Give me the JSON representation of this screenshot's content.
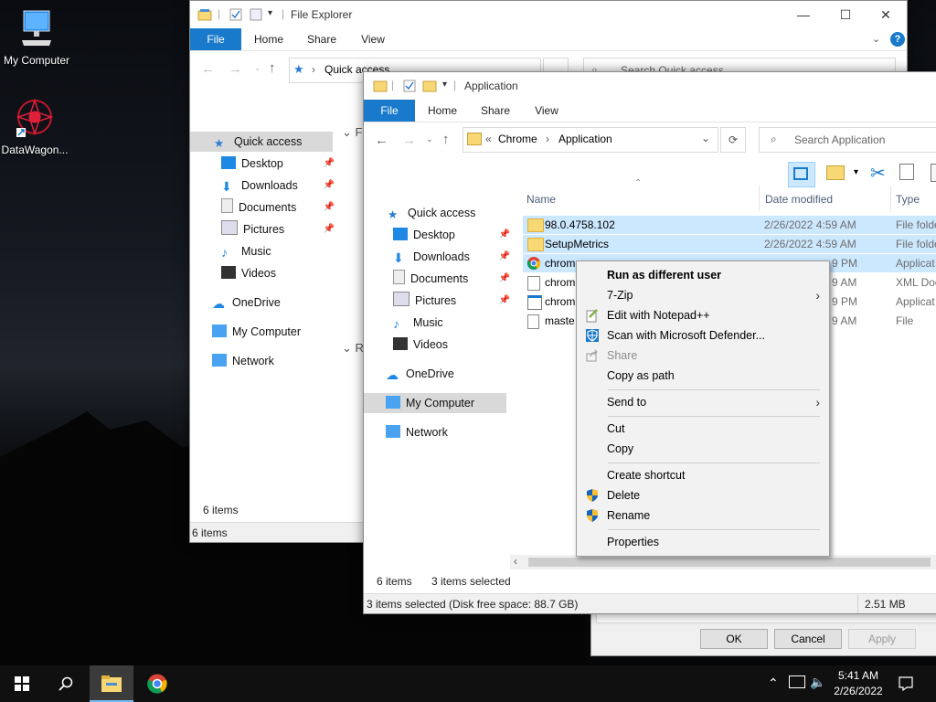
{
  "desktop": {
    "icons": [
      {
        "label": "My Computer"
      },
      {
        "label": "DataWagon..."
      }
    ]
  },
  "explorer_back": {
    "title": "File Explorer",
    "ribbon_tabs": [
      "File",
      "Home",
      "Share",
      "View"
    ],
    "address_text": "Quick access",
    "search_placeholder": "Search Quick access",
    "nav": [
      "Quick access",
      "Desktop",
      "Downloads",
      "Documents",
      "Pictures",
      "Music",
      "Videos",
      "OneDrive",
      "My Computer",
      "Network"
    ],
    "group_letters": [
      "F",
      "R"
    ],
    "status_items": "6 items",
    "status_bottom": "6 items"
  },
  "explorer_front": {
    "title": "Application",
    "ribbon_tabs": [
      "File",
      "Home",
      "Share",
      "View"
    ],
    "breadcrumb": {
      "prefix": "«",
      "parts": [
        "Chrome",
        "Application"
      ]
    },
    "search_placeholder": "Search Application",
    "nav": [
      "Quick access",
      "Desktop",
      "Downloads",
      "Documents",
      "Pictures",
      "Music",
      "Videos",
      "OneDrive",
      "My Computer",
      "Network"
    ],
    "columns": [
      "Name",
      "Date modified",
      "Type"
    ],
    "rows": [
      {
        "name": "98.0.4758.102",
        "date": "2/26/2022 4:59 AM",
        "type": "File folde"
      },
      {
        "name": "SetupMetrics",
        "date": "2/26/2022 4:59 AM",
        "type": "File folde"
      },
      {
        "name": "chrom",
        "date": "",
        "date_tail": "9 PM",
        "type": "Applicat"
      },
      {
        "name": "chrom",
        "date_tail": "9 AM",
        "type": "XML Doc"
      },
      {
        "name": "chrom",
        "date_tail": "9 PM",
        "type": "Applicat"
      },
      {
        "name": "maste",
        "date_tail": "9 AM",
        "type": "File"
      }
    ],
    "status_left": "6 items",
    "status_selected": "3 items selected",
    "status_bar": "3 items selected (Disk free space: 88.7 GB)",
    "status_size": "2.51 MB"
  },
  "context_menu": {
    "items": [
      {
        "label": "Run as different user",
        "bold": true
      },
      {
        "label": "7-Zip",
        "submenu": true
      },
      {
        "label": "Edit with Notepad++",
        "icon": "notepad-icon"
      },
      {
        "label": "Scan with Microsoft Defender...",
        "icon": "defender-icon"
      },
      {
        "label": "Share",
        "icon": "share-icon",
        "disabled": true
      },
      {
        "label": "Copy as path"
      },
      {
        "label": "Send to",
        "submenu": true
      },
      {
        "label": "Cut"
      },
      {
        "label": "Copy"
      },
      {
        "label": "Create shortcut"
      },
      {
        "label": "Delete",
        "icon": "shield-icon"
      },
      {
        "label": "Rename",
        "icon": "shield-icon"
      },
      {
        "label": "Properties"
      }
    ]
  },
  "dialog": {
    "ok": "OK",
    "cancel": "Cancel",
    "apply": "Apply"
  },
  "taskbar": {
    "time": "5:41 AM",
    "date": "2/26/2022"
  },
  "colors": {
    "accent": "#1979ca",
    "selection": "#cce8ff",
    "folder": "#f8d775"
  }
}
